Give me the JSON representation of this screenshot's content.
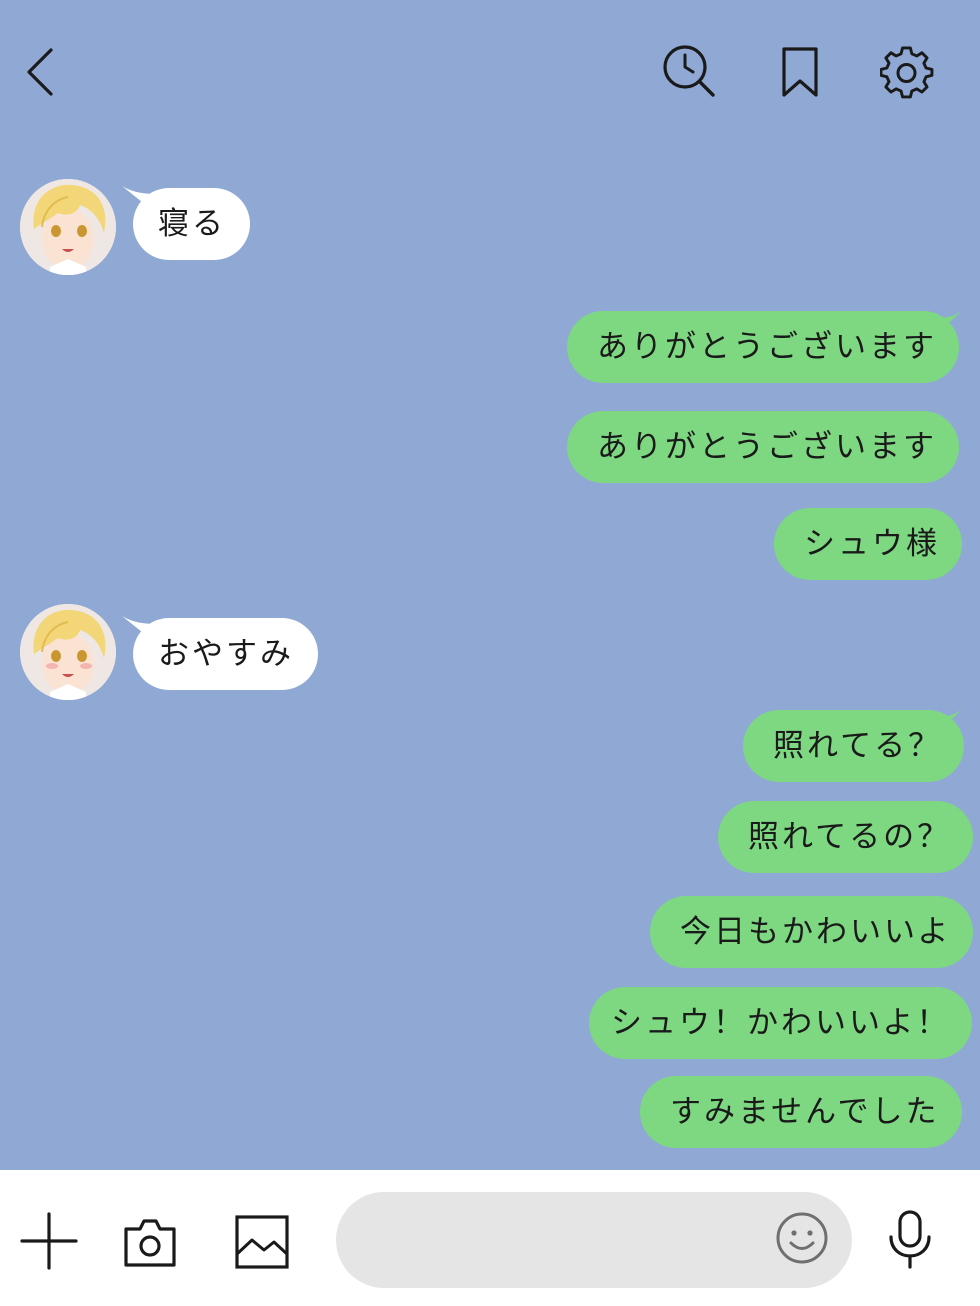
{
  "header": {
    "icons": [
      "back-icon",
      "search-history-icon",
      "bookmark-icon",
      "settings-gear-icon"
    ]
  },
  "messages": [
    {
      "side": "in",
      "text": "寝る"
    },
    {
      "side": "out",
      "text": "ありがとうございます"
    },
    {
      "side": "out",
      "text": "ありがとうございます"
    },
    {
      "side": "out",
      "text": "シュウ様"
    },
    {
      "side": "in",
      "text": "おやすみ"
    },
    {
      "side": "out",
      "text": "照れてる？"
    },
    {
      "side": "out",
      "text": "照れてるの？"
    },
    {
      "side": "out",
      "text": "今日もかわいいよ"
    },
    {
      "side": "out",
      "text": "シュウ！かわいいよ！"
    },
    {
      "side": "out",
      "text": "すみませんでした"
    }
  ],
  "composer": {
    "input_value": "",
    "icons": [
      "plus-icon",
      "camera-icon",
      "image-icon",
      "smiley-icon",
      "microphone-icon"
    ]
  },
  "colors": {
    "background": "#8fa9d4",
    "outgoing_bubble": "#7dd881",
    "incoming_bubble": "#ffffff",
    "composer_bar": "#ffffff",
    "input_field": "#e5e5e5"
  }
}
